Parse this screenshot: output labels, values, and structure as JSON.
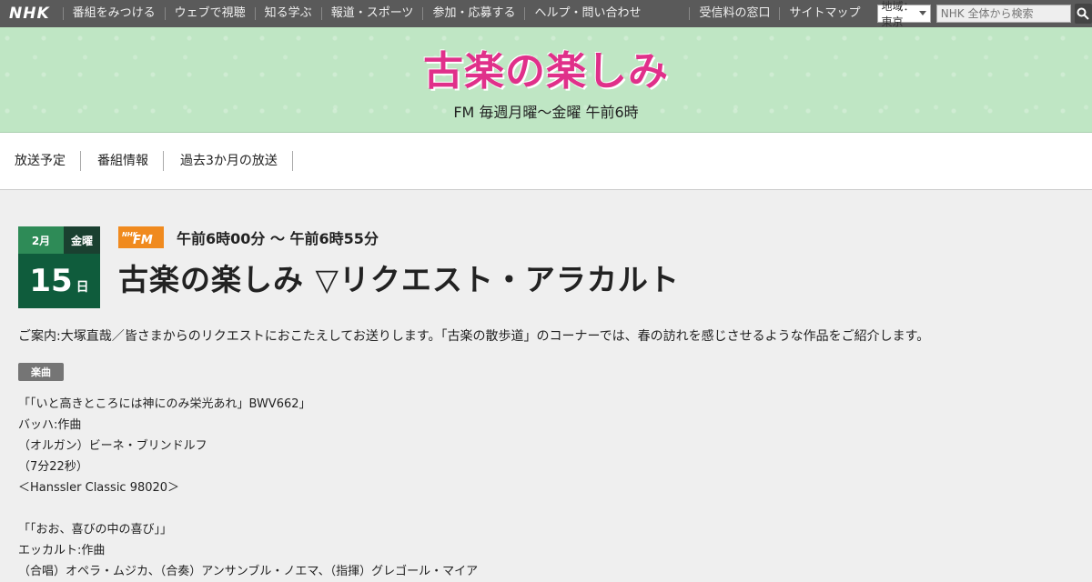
{
  "topbar": {
    "logo": "NHK",
    "nav": [
      "番組をみつける",
      "ウェブで視聴",
      "知る学ぶ",
      "報道・スポーツ",
      "参加・応募する",
      "ヘルプ・問い合わせ",
      ""
    ],
    "right": [
      "受信料の窓口",
      "サイトマップ"
    ],
    "region_label": "地域： 東京",
    "search_placeholder": "NHK 全体から検索"
  },
  "banner": {
    "title": "古楽の楽しみ",
    "subtitle": "FM 毎週月曜～金曜 午前6時"
  },
  "program_menu": [
    "放送予定",
    "番組情報",
    "過去3か月の放送"
  ],
  "episode": {
    "month": "2月",
    "weekday": "金曜",
    "day": "15",
    "day_unit": "日",
    "channel": "NHK-FM",
    "airtime": "午前6時00分 ～ 午前6時55分",
    "title": "古楽の楽しみ ▽リクエスト・アラカルト",
    "description": "ご案内:大塚直哉／皆さまからのリクエストにおこたえしてお送りします。「古楽の散歩道」のコーナーでは、春の訪れを感じさせるような作品をご紹介します。",
    "section_tag": "楽曲",
    "tracks": [
      "「「いと高きところには神にのみ栄光あれ」BWV662」",
      "バッハ:作曲",
      "（オルガン）ビーネ・ブリンドルフ",
      "（7分22秒）",
      "＜Hanssler Classic 98020＞",
      "",
      "「「おお、喜びの中の喜び」」",
      "エッカルト:作曲",
      "（合唱）オペラ・ムジカ、（合奏）アンサンブル・ノエマ、（指揮）グレゴール・マイア"
    ]
  }
}
